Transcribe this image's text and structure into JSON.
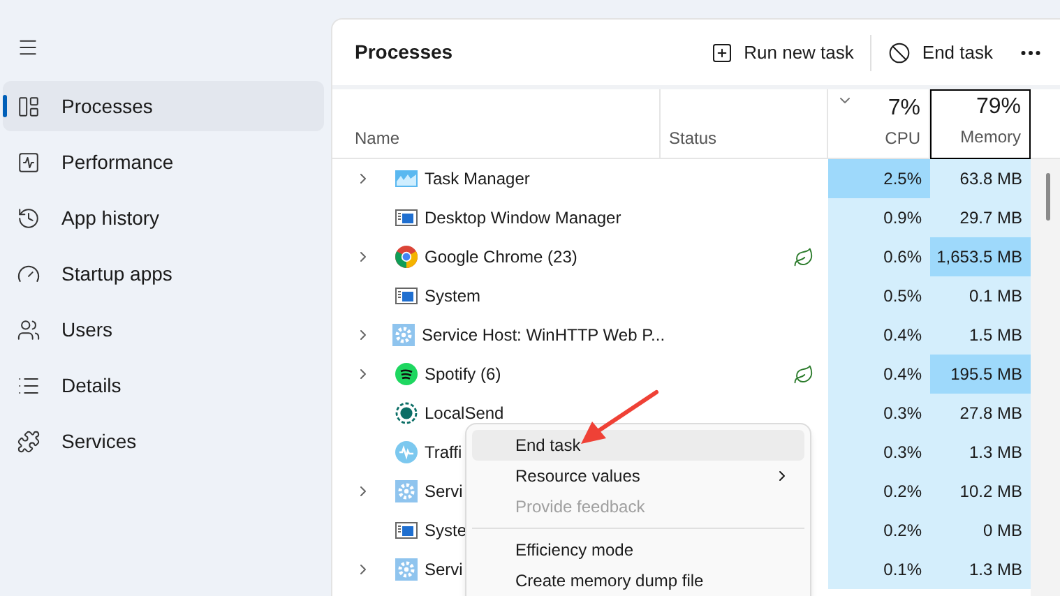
{
  "sidebar": {
    "items": [
      {
        "label": "Processes",
        "kind": "processes",
        "selected": true
      },
      {
        "label": "Performance",
        "kind": "performance",
        "selected": false
      },
      {
        "label": "App history",
        "kind": "history",
        "selected": false
      },
      {
        "label": "Startup apps",
        "kind": "startup",
        "selected": false
      },
      {
        "label": "Users",
        "kind": "users",
        "selected": false
      },
      {
        "label": "Details",
        "kind": "details",
        "selected": false
      },
      {
        "label": "Services",
        "kind": "services",
        "selected": false
      }
    ]
  },
  "header": {
    "title": "Processes",
    "actions": [
      {
        "kind": "run",
        "label": "Run new task"
      },
      {
        "kind": "end",
        "label": "End task"
      }
    ]
  },
  "columns": {
    "name": "Name",
    "status": "Status",
    "cpu": {
      "percent": "7%",
      "label": "CPU",
      "sorted": true
    },
    "memory": {
      "percent": "79%",
      "label": "Memory",
      "focused": true
    }
  },
  "rows": [
    {
      "name": "Task Manager",
      "kind": "taskmgr",
      "expandable": true,
      "efficiency": false,
      "cpu": "2.5%",
      "cpu_high": true,
      "memory": "63.8 MB",
      "memory_high": false
    },
    {
      "name": "Desktop Window Manager",
      "kind": "window",
      "expandable": false,
      "efficiency": false,
      "cpu": "0.9%",
      "cpu_high": false,
      "memory": "29.7 MB",
      "memory_high": false
    },
    {
      "name": "Google Chrome (23)",
      "kind": "chrome",
      "expandable": true,
      "efficiency": true,
      "cpu": "0.6%",
      "cpu_high": false,
      "memory": "1,653.5 MB",
      "memory_high": true
    },
    {
      "name": "System",
      "kind": "window",
      "expandable": false,
      "efficiency": false,
      "cpu": "0.5%",
      "cpu_high": false,
      "memory": "0.1 MB",
      "memory_high": false
    },
    {
      "name": "Service Host: WinHTTP Web P...",
      "kind": "gear",
      "expandable": true,
      "efficiency": false,
      "cpu": "0.4%",
      "cpu_high": false,
      "memory": "1.5 MB",
      "memory_high": false
    },
    {
      "name": "Spotify (6)",
      "kind": "spotify",
      "expandable": true,
      "efficiency": true,
      "cpu": "0.4%",
      "cpu_high": false,
      "memory": "195.5 MB",
      "memory_high": true
    },
    {
      "name": "LocalSend",
      "kind": "localsend",
      "expandable": false,
      "efficiency": false,
      "cpu": "0.3%",
      "cpu_high": false,
      "memory": "27.8 MB",
      "memory_high": false
    },
    {
      "name": "Traffi",
      "kind": "traffic",
      "expandable": false,
      "efficiency": false,
      "cpu": "0.3%",
      "cpu_high": false,
      "memory": "1.3 MB",
      "memory_high": false
    },
    {
      "name": "Servi",
      "kind": "gear",
      "expandable": true,
      "efficiency": false,
      "cpu": "0.2%",
      "cpu_high": false,
      "memory": "10.2 MB",
      "memory_high": false
    },
    {
      "name": "Syste",
      "kind": "window",
      "expandable": false,
      "efficiency": false,
      "cpu": "0.2%",
      "cpu_high": false,
      "memory": "0 MB",
      "memory_high": false
    },
    {
      "name": "Servi",
      "kind": "gear",
      "expandable": true,
      "efficiency": false,
      "cpu": "0.1%",
      "cpu_high": false,
      "memory": "1.3 MB",
      "memory_high": false
    }
  ],
  "context_menu": {
    "items": [
      {
        "kind": "item",
        "label": "End task",
        "hovered": true,
        "disabled": false,
        "submenu": false
      },
      {
        "kind": "item",
        "label": "Resource values",
        "hovered": false,
        "disabled": false,
        "submenu": true
      },
      {
        "kind": "item",
        "label": "Provide feedback",
        "hovered": false,
        "disabled": true,
        "submenu": false
      },
      {
        "kind": "separator"
      },
      {
        "kind": "item",
        "label": "Efficiency mode",
        "hovered": false,
        "disabled": false,
        "submenu": false
      },
      {
        "kind": "item",
        "label": "Create memory dump file",
        "hovered": false,
        "disabled": false,
        "submenu": false
      }
    ]
  }
}
